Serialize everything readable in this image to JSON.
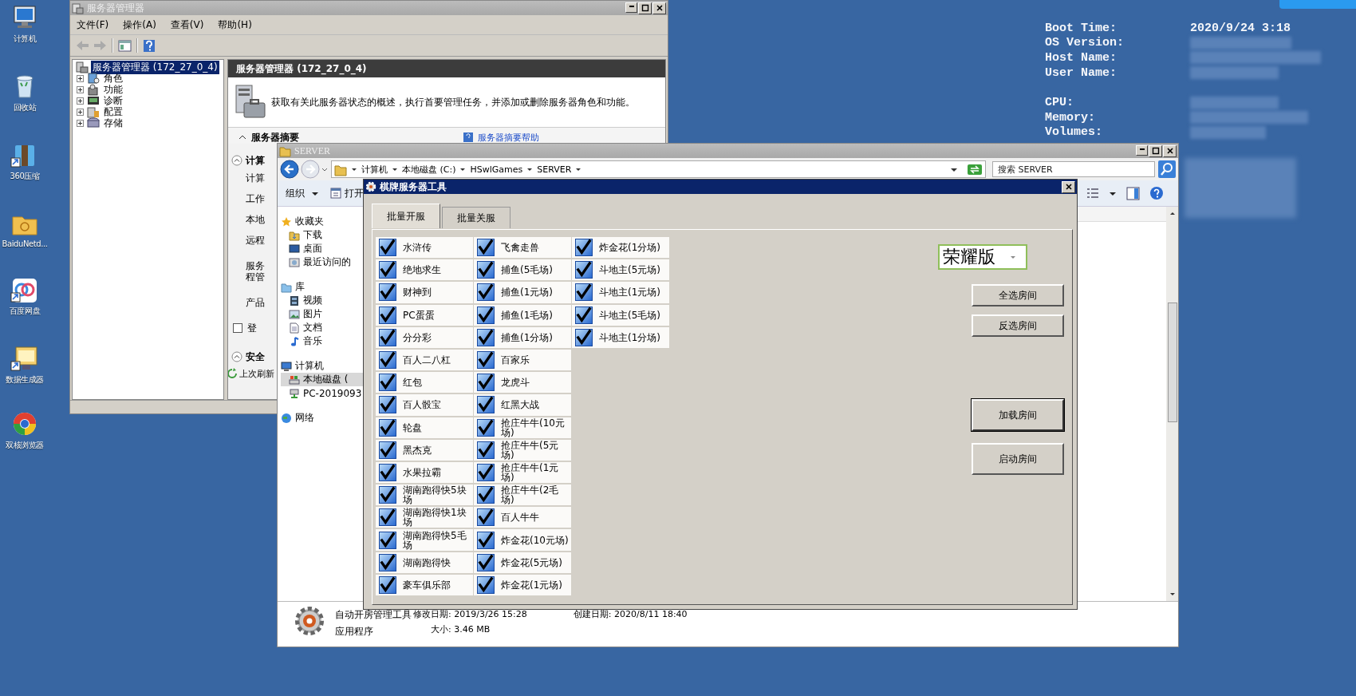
{
  "desktop_icons": [
    {
      "label": "计算机"
    },
    {
      "label": "回收站"
    },
    {
      "label": "360压缩"
    },
    {
      "label": "BaiduNetd..."
    },
    {
      "label": "百度网盘"
    },
    {
      "label": "数据生成器"
    },
    {
      "label": "双核浏览器"
    }
  ],
  "system_info": {
    "groups": [
      [
        {
          "label": "Boot Time:",
          "value": "2020/9/24 3:18"
        },
        {
          "label": "OS Version:"
        },
        {
          "label": "Host Name:"
        },
        {
          "label": "User Name:"
        }
      ],
      [
        {
          "label": "CPU:"
        },
        {
          "label": "Memory:"
        },
        {
          "label": "Volumes:"
        }
      ]
    ]
  },
  "server_manager": {
    "title": "服务器管理器",
    "menu": [
      "文件(F)",
      "操作(A)",
      "查看(V)",
      "帮助(H)"
    ],
    "tree": {
      "label": "服务器管理器 (172_27_0_4)",
      "selected": true,
      "children": [
        {
          "label": "角色",
          "expanded": false
        },
        {
          "label": "功能",
          "expanded": false
        },
        {
          "label": "诊断",
          "expanded": false
        },
        {
          "label": "配置",
          "expanded": false
        },
        {
          "label": "存储",
          "expanded": false
        }
      ]
    },
    "header": "服务器管理器 (172_27_0_4)",
    "description": "获取有关此服务器状态的概述，执行首要管理任务，并添加或删除服务器角色和功能。",
    "section": "服务器摘要",
    "help_link": "服务器摘要帮助",
    "subsection": "计算",
    "fields": [
      "计算",
      "工作",
      "本地",
      "远程",
      "服务",
      "程管",
      "产品"
    ],
    "checkbox": {
      "label": "登",
      "checked": false
    },
    "security": "安全",
    "refresh": "上次刷新"
  },
  "explorer": {
    "title": "SERVER",
    "breadcrumb": [
      "计算机",
      "本地磁盘 (C:)",
      "HSwlGames",
      "SERVER"
    ],
    "search": {
      "placeholder": "搜索 SERVER"
    },
    "toolbar": [
      "组织",
      "打开"
    ],
    "nav": [
      {
        "label": "收藏夹",
        "children": [
          {
            "label": "下载",
            "selected": false
          },
          {
            "label": "桌面",
            "selected": false
          },
          {
            "label": "最近访问的",
            "selected": false
          }
        ]
      },
      {
        "label": "库",
        "children": [
          {
            "label": "视频",
            "selected": false
          },
          {
            "label": "图片",
            "selected": false
          },
          {
            "label": "文档",
            "selected": false
          },
          {
            "label": "音乐",
            "selected": false
          }
        ]
      },
      {
        "label": "计算机",
        "children": [
          {
            "label": "本地磁盘 (",
            "selected": true
          },
          {
            "label": "PC-2019093",
            "selected": false
          }
        ]
      },
      {
        "label": "网络"
      }
    ],
    "details": {
      "name": "自动开房管理工具",
      "type": "应用程序",
      "modified": "修改日期: 2019/3/26 15:28",
      "size": "大小: 3.46 MB",
      "created": "创建日期: 2020/8/11 18:40"
    }
  },
  "tool": {
    "title": "棋牌服务器工具",
    "tabs": [
      {
        "label": "批量开服",
        "selected": true
      },
      {
        "label": "批量关服",
        "selected": false
      }
    ],
    "columns": [
      {
        "items": [
          {
            "label": "水浒传",
            "checked": true
          },
          {
            "label": "绝地求生",
            "checked": true
          },
          {
            "label": "财神到",
            "checked": true
          },
          {
            "label": "PC蛋蛋",
            "checked": true
          },
          {
            "label": "分分彩",
            "checked": true
          },
          {
            "label": "百人二八杠",
            "checked": true
          },
          {
            "label": "红包",
            "checked": true
          },
          {
            "label": "百人骰宝",
            "checked": true
          },
          {
            "label": "轮盘",
            "checked": true
          },
          {
            "label": "黑杰克",
            "checked": true
          },
          {
            "label": "水果拉霸",
            "checked": true
          },
          {
            "label": "湖南跑得快5块场",
            "checked": true
          },
          {
            "label": "湖南跑得快1块场",
            "checked": true
          },
          {
            "label": "湖南跑得快5毛场",
            "checked": true
          },
          {
            "label": "湖南跑得快",
            "checked": true
          },
          {
            "label": "豪车俱乐部",
            "checked": true
          }
        ]
      },
      {
        "items": [
          {
            "label": "飞禽走兽",
            "checked": true
          },
          {
            "label": "捕鱼(5毛场)",
            "checked": true
          },
          {
            "label": "捕鱼(1元场)",
            "checked": true
          },
          {
            "label": "捕鱼(1毛场)",
            "checked": true
          },
          {
            "label": "捕鱼(1分场)",
            "checked": true
          },
          {
            "label": "百家乐",
            "checked": true
          },
          {
            "label": "龙虎斗",
            "checked": true
          },
          {
            "label": "红黑大战",
            "checked": true
          },
          {
            "label": "抢庄牛牛(10元场)",
            "checked": true
          },
          {
            "label": "抢庄牛牛(5元场)",
            "checked": true
          },
          {
            "label": "抢庄牛牛(1元场)",
            "checked": true
          },
          {
            "label": "抢庄牛牛(2毛场)",
            "checked": true
          },
          {
            "label": "百人牛牛",
            "checked": true
          },
          {
            "label": "炸金花(10元场)",
            "checked": true
          },
          {
            "label": "炸金花(5元场)",
            "checked": true
          },
          {
            "label": "炸金花(1元场)",
            "checked": true
          }
        ]
      },
      {
        "items": [
          {
            "label": "炸金花(1分场)",
            "checked": true
          },
          {
            "label": "斗地主(5元场)",
            "checked": true
          },
          {
            "label": "斗地主(1元场)",
            "checked": true
          },
          {
            "label": "斗地主(5毛场)",
            "checked": true
          },
          {
            "label": "斗地主(1分场)",
            "checked": true
          }
        ]
      }
    ],
    "edition": {
      "value": "荣耀版"
    },
    "top_buttons": [
      {
        "label": "全选房间",
        "default": false
      },
      {
        "label": "反选房间",
        "default": false
      }
    ],
    "bottom_buttons": [
      {
        "label": "加载房间",
        "default": true
      },
      {
        "label": "启动房间",
        "default": false
      }
    ]
  }
}
